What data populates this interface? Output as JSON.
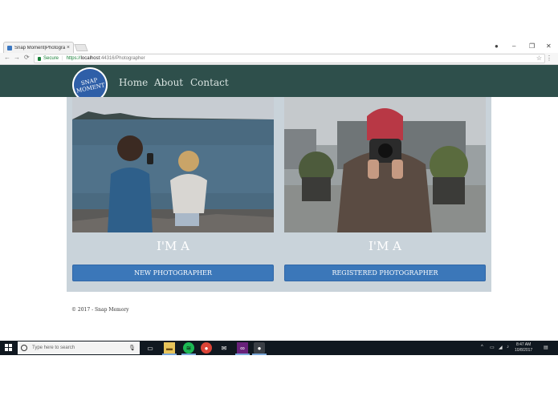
{
  "browser": {
    "tab_title": "Snap Moment|Photogra",
    "tab_close": "×",
    "secure_label": "Secure",
    "url_scheme": "https://",
    "url_host": "localhost",
    "url_path": ":44316/Photographer",
    "back_icon": "←",
    "forward_icon": "→",
    "reload_icon": "⟳",
    "star_icon": "☆",
    "menu_icon": "⋮",
    "minimize": "–",
    "maximize": "❐",
    "close": "✕",
    "profile_icon": "●"
  },
  "site": {
    "logo_line1": "SNAP",
    "logo_line2": "MOMENT",
    "nav": [
      "Home",
      "About",
      "Contact"
    ],
    "colors": {
      "header": "#2e4f4b",
      "button": "#3b77b9",
      "panel": "#c9d3da"
    }
  },
  "cards": [
    {
      "heading": "I'M A",
      "button": "NEW PHOTOGRAPHER",
      "photo": "photographer-on-shore"
    },
    {
      "heading": "I'M A",
      "button": "REGISTERED PHOTOGRAPHER",
      "photo": "camera-selfie"
    }
  ],
  "footer": {
    "text": "© 2017 - Snap Memory"
  },
  "taskbar": {
    "search_placeholder": "Type here to search",
    "time": "8:47 AM",
    "date": "10/8/2017"
  }
}
